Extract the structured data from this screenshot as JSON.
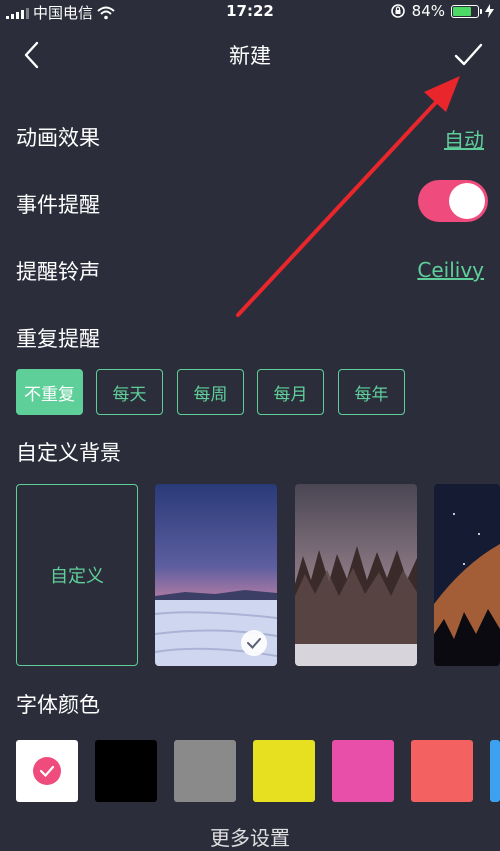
{
  "status": {
    "carrier": "中国电信",
    "time": "17:22",
    "battery": "84%",
    "battery_level": 0.84
  },
  "nav": {
    "title": "新建"
  },
  "settings": {
    "animation_label": "动画效果",
    "animation_value": "自动",
    "reminder_label": "事件提醒",
    "reminder_on": true,
    "ringtone_label": "提醒铃声",
    "ringtone_value": "Ceilivy",
    "repeat_label": "重复提醒",
    "repeat_options": [
      "不重复",
      "每天",
      "每周",
      "每月",
      "每年"
    ],
    "repeat_selected": "不重复"
  },
  "background": {
    "label": "自定义背景",
    "custom_label": "自定义"
  },
  "font_color": {
    "label": "字体颜色",
    "swatches": [
      "#ffffff",
      "#000000",
      "#8a8a8a",
      "#e6e020",
      "#e84fa8",
      "#f46161",
      "#3da1f2"
    ]
  },
  "more_label": "更多设置",
  "colors": {
    "accent": "#5fcf9a",
    "toggle": "#ef4b7d",
    "arrow": "#e8262c",
    "background": "#2b2e3a"
  }
}
